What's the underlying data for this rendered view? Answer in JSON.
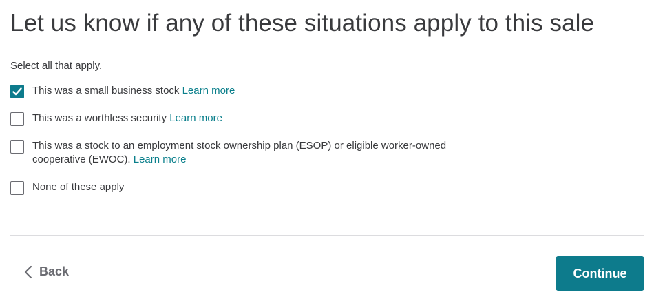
{
  "title": "Let us know if any of these situations apply to this sale",
  "instructions": "Select all that apply.",
  "options": [
    {
      "text": "This was a small business stock",
      "link": "Learn more",
      "checked": true
    },
    {
      "text": "This was a worthless security",
      "link": "Learn more",
      "checked": false
    },
    {
      "text": "This was a stock to an employment stock ownership plan (ESOP) or eligible worker-owned cooperative (EWOC).",
      "link": "Learn more",
      "checked": false
    },
    {
      "text": "None of these apply",
      "link": "",
      "checked": false
    }
  ],
  "footer": {
    "back_label": "Back",
    "continue_label": "Continue"
  },
  "colors": {
    "accent": "#0d7b8c",
    "link": "#0a7f8b",
    "text": "#393a3d"
  },
  "icons": {
    "back": "chevron-left-icon",
    "check": "checkmark-icon"
  }
}
